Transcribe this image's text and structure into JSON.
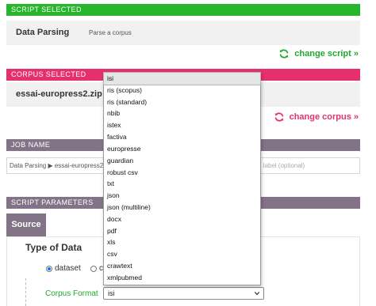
{
  "script_section": {
    "header": "SCRIPT SELECTED",
    "name": "Data Parsing",
    "description": "Parse a corpus",
    "change_label": "change script »",
    "accent": "#27b52b"
  },
  "corpus_section": {
    "header": "CORPUS SELECTED",
    "name": "essai-europress2.zip",
    "change_label": "change corpus »",
    "accent": "#e6306e"
  },
  "job_section": {
    "header": "JOB NAME",
    "path": "Data Parsing ▶ essai-europress2",
    "label_placeholder": "o label (optional)"
  },
  "params_section": {
    "header": "SCRIPT PARAMETERS",
    "tab_label": "Source",
    "type_title": "Type of Data",
    "radio_dataset": "dataset",
    "radio_other": "co",
    "format_label": "Corpus Format",
    "format_value": "isi"
  },
  "dropdown": {
    "options": [
      "isi",
      "ris (scopus)",
      "ris (standard)",
      "nbib",
      "istex",
      "factiva",
      "europresse",
      "guardian",
      "robust csv",
      "txt",
      "json",
      "json (multiline)",
      "docx",
      "pdf",
      "xls",
      "csv",
      "crawtext",
      "xmlpubmed"
    ],
    "selected": "isi"
  }
}
